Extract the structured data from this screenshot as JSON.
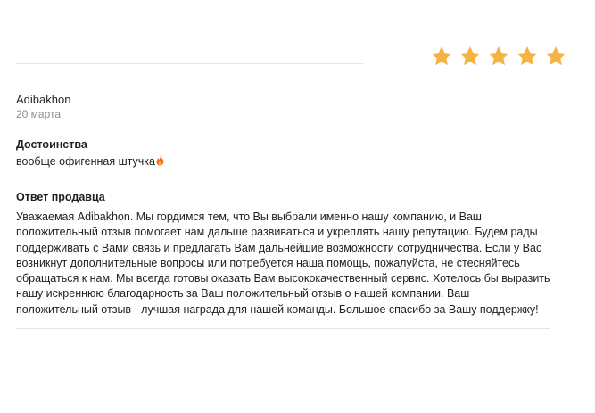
{
  "rating": {
    "stars": 5,
    "max": 5,
    "color": "#f5b342"
  },
  "review": {
    "author": "Adibakhon",
    "date": "20 марта",
    "pros_title": "Достоинства",
    "pros_text": "вообще офигенная штучка",
    "pros_emoji_icon": "fire-icon"
  },
  "seller_reply": {
    "title": "Ответ продавца",
    "text": "Уважаемая Adibakhon. Мы гордимся тем, что Вы выбрали именно нашу компанию, и Ваш положительный отзыв помогает нам дальше развиваться и укреплять нашу репутацию. Будем рады поддерживать с Вами связь и предлагать Вам дальнейшие возможности сотрудничества. Если у Вас возникнут дополнительные вопросы или потребуется наша помощь, пожалуйста, не стесняйтесь обращаться к нам. Мы всегда готовы оказать Вам высококачественный сервис. Хотелось бы выразить нашу искреннюю благодарность за Ваш положительный отзыв о нашей компании. Ваш положительный отзыв - лучшая награда для нашей команды. Большое спасибо за Вашу поддержку!"
  }
}
